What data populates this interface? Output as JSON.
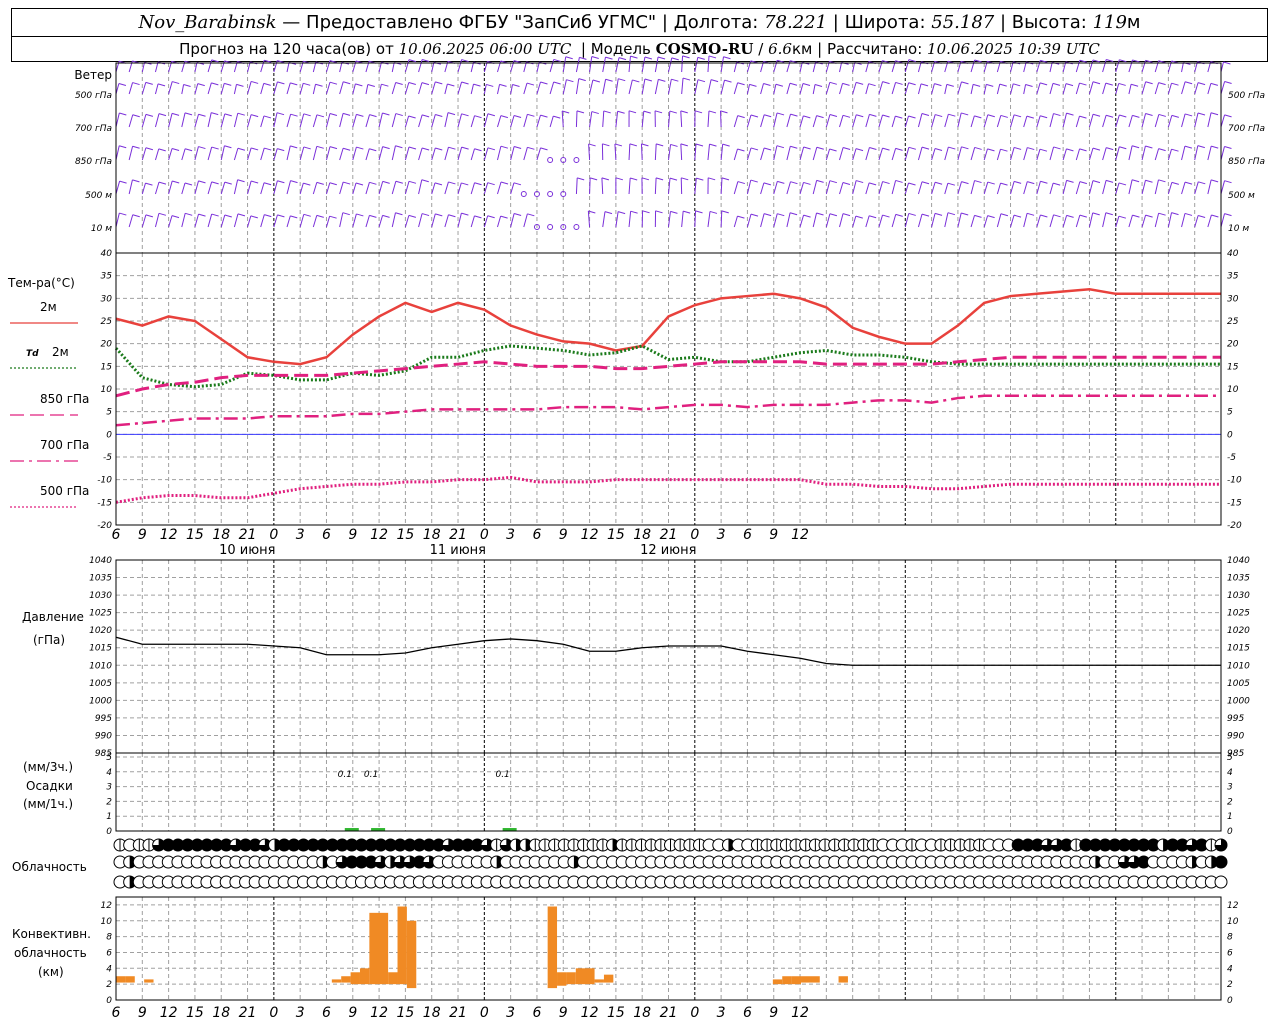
{
  "header": {
    "station": "Nov_Barabinsk",
    "dash": "—",
    "provider": "Предоставлено ФГБУ \"ЗапСиб УГМС\"",
    "lon_label": "Долгота:",
    "lon_value": "78.221",
    "lat_label": "Широта:",
    "lat_value": "55.187",
    "alt_label": "Высота:",
    "alt_value": "119",
    "alt_unit": "м",
    "forecast_label": "Прогноз на 120 часа(ов) от",
    "forecast_time": "10.06.2025 06:00 UTC",
    "model_label": "Модель",
    "model_name": "COSMO-RU",
    "model_res": "6.6",
    "model_res_unit": "км",
    "calc_label": "Рассчитано:",
    "calc_time": "10.06.2025 10:39 UTC"
  },
  "colors": {
    "t2m": "#e8413c",
    "td2m": "#1a7a1a",
    "t850": "#e0207f",
    "t700": "#e0207f",
    "t500": "#e0207f",
    "wind": "#7a2fd9",
    "pressure": "#000000",
    "precip": "#2fb52f",
    "convective": "#f08a24",
    "zero_line": "#3a3aff",
    "grid": "#a0a0a0"
  },
  "x_axis": {
    "hour_labels": [
      "6",
      "9",
      "12",
      "15",
      "18",
      "21",
      "0",
      "3",
      "6",
      "9",
      "12",
      "15",
      "18",
      "21",
      "0",
      "3",
      "6",
      "9",
      "12",
      "15",
      "18",
      "21",
      "0",
      "3",
      "6",
      "9",
      "12"
    ],
    "date_labels": [
      "10 июня",
      "11 июня",
      "12 июня"
    ]
  },
  "wind_panel": {
    "title": "Ветер",
    "levels": [
      "500 гПа",
      "700 гПа",
      "850 гПа",
      "500 м",
      "10 м"
    ],
    "right_levels": [
      "500 гПа",
      "700 гПа",
      "850 гПа",
      "500 м",
      "10 м"
    ]
  },
  "temp_panel": {
    "title": "Тем-ра(°C)",
    "legend": [
      {
        "name": "2м",
        "key": "t2m",
        "style": "solid"
      },
      {
        "name": "Td 2м",
        "key": "td2m",
        "style": "dotted"
      },
      {
        "name": "850 гПа",
        "key": "t850",
        "style": "dashed"
      },
      {
        "name": "700 гПа",
        "key": "t700",
        "style": "dashdot"
      },
      {
        "name": "500 гПа",
        "key": "t500",
        "style": "dotted"
      }
    ],
    "legend_td_prefix": "Td",
    "legend_td_suffix": "2м",
    "y_ticks": [
      "40",
      "35",
      "30",
      "25",
      "20",
      "15",
      "10",
      "5",
      "0",
      "-5",
      "-10",
      "-15",
      "-20"
    ]
  },
  "pressure_panel": {
    "title_line1": "Давление",
    "title_line2": "(гПа)",
    "y_ticks": [
      "1040",
      "1035",
      "1030",
      "1025",
      "1020",
      "1015",
      "1010",
      "1005",
      "1000",
      "995",
      "990",
      "985"
    ]
  },
  "precip_panel": {
    "title_line1": "(мм/3ч.)",
    "title_line2": "Осадки",
    "title_line3": "(мм/1ч.)",
    "y_ticks": [
      "5",
      "4",
      "3",
      "2",
      "1",
      "0"
    ],
    "labels": [
      "0.1",
      "0.1",
      "0.1"
    ]
  },
  "cloud_panel": {
    "title": "Облачность"
  },
  "conv_panel": {
    "title_line1": "Конвективн.",
    "title_line2": "облачность",
    "title_line3": "(км)",
    "y_ticks": [
      "12",
      "10",
      "8",
      "6",
      "4",
      "2",
      "0"
    ]
  },
  "chart_data": {
    "type": "line",
    "x_hours_from_start": [
      0,
      3,
      6,
      9,
      12,
      15,
      18,
      21,
      24,
      27,
      30,
      33,
      36,
      39,
      42,
      45,
      48,
      51,
      54,
      57,
      60,
      63,
      66,
      69,
      72,
      75,
      78,
      81,
      84,
      87,
      90,
      93,
      96,
      99,
      102,
      105,
      108,
      111,
      114,
      117,
      120,
      123,
      126
    ],
    "x_hour_of_day_labels_note": "start 10.06.2025 06 UTC",
    "series": [
      {
        "name": "2м",
        "key": "t2m",
        "values": [
          25.5,
          24,
          26,
          25,
          21,
          17,
          16,
          15.5,
          17,
          22,
          26,
          29,
          27,
          29,
          27.5,
          24,
          22,
          20.5,
          20,
          18.5,
          19.5,
          26,
          28.5,
          30,
          30.5,
          31,
          30,
          28,
          23.5,
          21.5,
          20,
          20,
          24,
          29,
          30.5,
          31,
          31.5,
          32,
          31,
          31,
          31,
          31,
          31
        ]
      },
      {
        "name": "Td 2м",
        "key": "td2m",
        "values": [
          19,
          12.5,
          11,
          10.5,
          11,
          13.5,
          13,
          12,
          12,
          13.5,
          13,
          14,
          17,
          17,
          18.5,
          19.5,
          19,
          18.5,
          17.5,
          18,
          19.5,
          16.5,
          17,
          16,
          16,
          17,
          18,
          18.5,
          17.5,
          17.5,
          17,
          16,
          15.5,
          15.5,
          15.5,
          15.5,
          15.5,
          15.5,
          15.5,
          15.5,
          15.5,
          15.5,
          15.5
        ]
      },
      {
        "name": "850 гПа",
        "key": "t850",
        "values": [
          8.5,
          10,
          11,
          11.5,
          12.5,
          13,
          13,
          13,
          13,
          13.5,
          14,
          14.5,
          15,
          15.5,
          16,
          15.5,
          15,
          15,
          15,
          14.5,
          14.5,
          15,
          15.5,
          16,
          16,
          16,
          16,
          15.5,
          15.5,
          15.5,
          15.5,
          15.5,
          16,
          16.5,
          17,
          17,
          17,
          17,
          17,
          17,
          17,
          17,
          17
        ]
      },
      {
        "name": "700 гПа",
        "key": "t700",
        "values": [
          2,
          2.5,
          3,
          3.5,
          3.5,
          3.5,
          4,
          4,
          4,
          4.5,
          4.5,
          5,
          5.5,
          5.5,
          5.5,
          5.5,
          5.5,
          6,
          6,
          6,
          5.5,
          6,
          6.5,
          6.5,
          6,
          6.5,
          6.5,
          6.5,
          7,
          7.5,
          7.5,
          7,
          8,
          8.5,
          8.5,
          8.5,
          8.5,
          8.5,
          8.5,
          8.5,
          8.5,
          8.5,
          8.5
        ]
      },
      {
        "name": "500 гПа",
        "key": "t500",
        "values": [
          -15,
          -14,
          -13.5,
          -13.5,
          -14,
          -14,
          -13,
          -12,
          -11.5,
          -11,
          -11,
          -10.5,
          -10.5,
          -10,
          -10,
          -9.5,
          -10.5,
          -10.5,
          -10.5,
          -10,
          -10,
          -10,
          -10,
          -10,
          -10,
          -10,
          -10,
          -11,
          -11,
          -11.5,
          -11.5,
          -12,
          -12,
          -11.5,
          -11,
          -11,
          -11,
          -11,
          -11,
          -11,
          -11,
          -11,
          -11
        ]
      },
      {
        "name": "Давление",
        "key": "pressure",
        "values": [
          1018,
          1016,
          1016,
          1016,
          1016,
          1016,
          1015.5,
          1015,
          1013,
          1013,
          1013,
          1013.5,
          1015,
          1016,
          1017,
          1017.5,
          1017,
          1016,
          1014,
          1014,
          1015,
          1015.5,
          1015.5,
          1015.5,
          1014,
          1013,
          1012,
          1010.5,
          1010,
          1010,
          1010,
          1010,
          1010,
          1010,
          1010,
          1010,
          1010,
          1010,
          1010,
          1010,
          1010,
          1010,
          1010
        ]
      }
    ],
    "precipitation": [
      {
        "hour_offset": 27,
        "value": 0.1,
        "label": "0.1"
      },
      {
        "hour_offset": 30,
        "value": 0.1,
        "label": "0.1"
      },
      {
        "hour_offset": 45,
        "value": 0.1,
        "label": "0.1"
      }
    ],
    "convective_clouds": [
      {
        "from": 0,
        "to": 1,
        "bottom": 2.2,
        "top": 3
      },
      {
        "from": 1,
        "to": 2,
        "bottom": 2.2,
        "top": 3
      },
      {
        "from": 3,
        "to": 4,
        "bottom": 2.2,
        "top": 2.6
      },
      {
        "from": 23,
        "to": 24,
        "bottom": 2.2,
        "top": 2.6
      },
      {
        "from": 24,
        "to": 25,
        "bottom": 2.2,
        "top": 3
      },
      {
        "from": 25,
        "to": 26,
        "bottom": 2,
        "top": 3.5
      },
      {
        "from": 26,
        "to": 27,
        "bottom": 2,
        "top": 4
      },
      {
        "from": 27,
        "to": 29,
        "bottom": 2,
        "top": 11
      },
      {
        "from": 29,
        "to": 30,
        "bottom": 2,
        "top": 3.5
      },
      {
        "from": 30,
        "to": 31,
        "bottom": 2,
        "top": 11.8
      },
      {
        "from": 31,
        "to": 32,
        "bottom": 1.5,
        "top": 10
      },
      {
        "from": 46,
        "to": 47,
        "bottom": 1.5,
        "top": 11.8
      },
      {
        "from": 47,
        "to": 48,
        "bottom": 1.8,
        "top": 3.5
      },
      {
        "from": 48,
        "to": 49,
        "bottom": 2,
        "top": 3.5
      },
      {
        "from": 49,
        "to": 51,
        "bottom": 2,
        "top": 4
      },
      {
        "from": 51,
        "to": 52,
        "bottom": 2.2,
        "top": 2.6
      },
      {
        "from": 52,
        "to": 53,
        "bottom": 2.2,
        "top": 3.2
      },
      {
        "from": 70,
        "to": 71,
        "bottom": 2,
        "top": 2.6
      },
      {
        "from": 71,
        "to": 72,
        "bottom": 2,
        "top": 3
      },
      {
        "from": 72,
        "to": 73,
        "bottom": 2,
        "top": 3
      },
      {
        "from": 73,
        "to": 75,
        "bottom": 2.2,
        "top": 3
      },
      {
        "from": 77,
        "to": 78,
        "bottom": 2.2,
        "top": 3
      }
    ],
    "cloud_cover_rows": {
      "upper": [
        1,
        0,
        1,
        1,
        3,
        4,
        4,
        4,
        4,
        4,
        4,
        4,
        3,
        4,
        4,
        3,
        2,
        4,
        4,
        4,
        4,
        4,
        4,
        4,
        4,
        4,
        4,
        4,
        4,
        4,
        4,
        4,
        4,
        4,
        3,
        4,
        4,
        4,
        3,
        1,
        3,
        2,
        2,
        1,
        1,
        1,
        1,
        1,
        1,
        1,
        1,
        2,
        1,
        1,
        1,
        1,
        1,
        1,
        1,
        1,
        1,
        0,
        0,
        2,
        0,
        0,
        1,
        1,
        1,
        1,
        1,
        1,
        1,
        1,
        1,
        1,
        1,
        1,
        1,
        0,
        0,
        0,
        1,
        0,
        0,
        1,
        1,
        1,
        1,
        1,
        0,
        0,
        0,
        4,
        4,
        4,
        3,
        3,
        4,
        1,
        4,
        4,
        4,
        4,
        4,
        4,
        4,
        4,
        2,
        4,
        4,
        3,
        4,
        1,
        3
      ],
      "middle": [
        0,
        2,
        0,
        0,
        0,
        0,
        0,
        0,
        0,
        0,
        0,
        0,
        0,
        0,
        0,
        0,
        0,
        0,
        0,
        0,
        0,
        2,
        0,
        3,
        4,
        4,
        4,
        3,
        2,
        3,
        3,
        4,
        3,
        0,
        0,
        0,
        0,
        0,
        0,
        2,
        0,
        0,
        0,
        0,
        0,
        0,
        0,
        2,
        0,
        0,
        0,
        0,
        0,
        0,
        0,
        0,
        0,
        0,
        0,
        0,
        0,
        0,
        0,
        0,
        0,
        0,
        0,
        0,
        0,
        0,
        0,
        0,
        0,
        0,
        0,
        0,
        0,
        0,
        0,
        0,
        0,
        0,
        0,
        0,
        0,
        0,
        0,
        0,
        0,
        0,
        0,
        0,
        0,
        0,
        0,
        0,
        0,
        0,
        0,
        0,
        0,
        2,
        0,
        0,
        3,
        3,
        4,
        0,
        0,
        0,
        0,
        2,
        0,
        2,
        4
      ],
      "lower": [
        0,
        2,
        0,
        0,
        0,
        0,
        0,
        0,
        0,
        0,
        0,
        0,
        0,
        0,
        0,
        0,
        0,
        0,
        0,
        0,
        0,
        0,
        0,
        0,
        0,
        0,
        0,
        0,
        0,
        0,
        0,
        0,
        0,
        0,
        0,
        0,
        0,
        0,
        0,
        0,
        0,
        0,
        0,
        0,
        0,
        0,
        0,
        0,
        0,
        0,
        0,
        0,
        0,
        0,
        0,
        0,
        0,
        0,
        0,
        0,
        0,
        0,
        0,
        0,
        0,
        0,
        0,
        0,
        0,
        0,
        0,
        0,
        0,
        0,
        0,
        0,
        0,
        0,
        0,
        0,
        0,
        0,
        0,
        0,
        0,
        0,
        0,
        0,
        0,
        0,
        0,
        0,
        0,
        0,
        0,
        0,
        0,
        0,
        0,
        0,
        0,
        0,
        0,
        0,
        0,
        0,
        0,
        0,
        0,
        0,
        0,
        0,
        0,
        0,
        0
      ]
    },
    "temp_ylim": [
      -20,
      40
    ],
    "pressure_ylim": [
      985,
      1040
    ],
    "precip_ylim": [
      0,
      5
    ],
    "conv_ylim": [
      0,
      13
    ],
    "grid": true
  }
}
